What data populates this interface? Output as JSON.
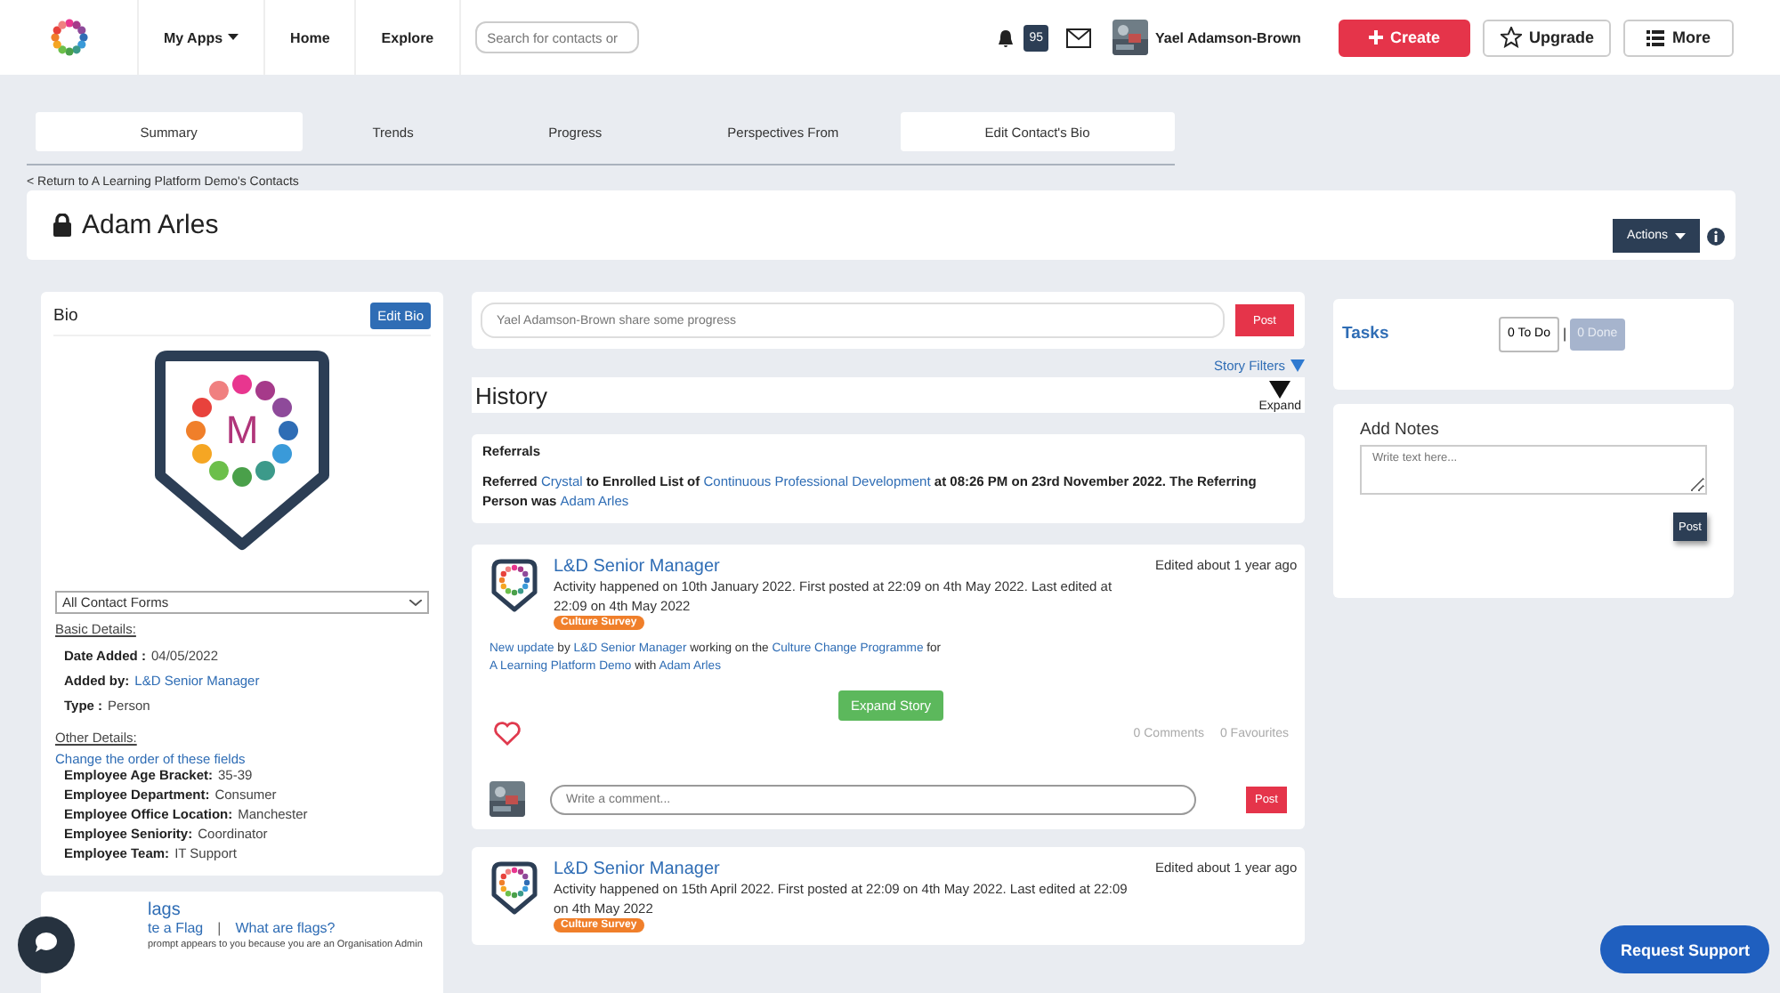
{
  "nav": {
    "menu": [
      {
        "label": "My Apps",
        "dropdown": true
      },
      {
        "label": "Home",
        "dropdown": false
      },
      {
        "label": "Explore",
        "dropdown": false
      }
    ],
    "search": {
      "placeholder": "Search for contacts or"
    },
    "notifications": "95",
    "user": "Yael Adamson-Brown",
    "buttons": [
      {
        "label": "Create",
        "kind": "primary"
      },
      {
        "label": "Upgrade",
        "kind": "star"
      },
      {
        "label": "More",
        "kind": "list"
      }
    ]
  },
  "tabs": [
    {
      "label": "Summary",
      "selected": true,
      "kind": "tab"
    },
    {
      "label": "Trends",
      "selected": false,
      "kind": "tab"
    },
    {
      "label": "Progress",
      "selected": false,
      "kind": "tab"
    },
    {
      "label": "Perspectives From",
      "selected": false,
      "kind": "tab"
    },
    {
      "label": "Edit Contact's Bio",
      "kind": "button"
    }
  ],
  "back_link": "< Return to A Learning Platform Demo's Contacts",
  "contact": {
    "name": "Adam Arles",
    "locked": true,
    "actions": "Actions"
  },
  "bio": {
    "title": "Bio",
    "edit": "Edit Bio",
    "logo_letter": "M",
    "form_select": "All Contact Forms",
    "basic_heading": "Basic Details:",
    "basic": [
      {
        "label": "Date Added :",
        "value": "04/05/2022",
        "kind": "text"
      },
      {
        "label": "Added by:",
        "value": "L&D Senior Manager",
        "kind": "link"
      },
      {
        "label": "Type :",
        "value": "Person",
        "kind": "text"
      }
    ],
    "other_heading": "Other Details:",
    "reorder_link": "Change the order of these fields",
    "other": [
      {
        "label": "Employee Age Bracket:",
        "value": "35-39"
      },
      {
        "label": "Employee Department:",
        "value": "Consumer"
      },
      {
        "label": "Employee Office Location:",
        "value": "Manchester"
      },
      {
        "label": "Employee Seniority:",
        "value": "Coordinator"
      },
      {
        "label": "Employee Team:",
        "value": "IT Support"
      }
    ]
  },
  "flags": {
    "title": "lags",
    "links": [
      "te a Flag",
      "What are flags?"
    ],
    "separator": "|",
    "note": "prompt appears to you because you are an Organisation Admin"
  },
  "composer": {
    "placeholder": "Yael Adamson-Brown share some progress",
    "button": "Post"
  },
  "story_filters": "Story Filters",
  "history": {
    "title": "History",
    "expand": "Expand"
  },
  "referrals": {
    "title": "Referrals",
    "parts": [
      {
        "kind": "text",
        "text": "Referred"
      },
      {
        "kind": "link",
        "text": "Crystal"
      },
      {
        "kind": "text",
        "text": "to Enrolled List of"
      },
      {
        "kind": "link",
        "text": "Continuous Professional Development"
      },
      {
        "kind": "text",
        "text": "at 08:26 PM on 23rd November 2022. The Referring Person was"
      },
      {
        "kind": "link",
        "text": "Adam Arles"
      }
    ]
  },
  "stories": [
    {
      "author": "L&D Senior Manager",
      "activity": "Activity happened on 10th January 2022. First posted at 22:09 on 4th May 2022. Last edited at 22:09 on 4th May 2022",
      "edited": "Edited about 1 year ago",
      "tag": "Culture Survey",
      "update": [
        {
          "kind": "link",
          "text": "New update"
        },
        {
          "kind": "text",
          "text": "by"
        },
        {
          "kind": "link",
          "text": "L&D Senior Manager"
        },
        {
          "kind": "text",
          "text": "working on the"
        },
        {
          "kind": "link",
          "text": "Culture Change Programme"
        },
        {
          "kind": "text",
          "text": "for"
        },
        {
          "kind": "link",
          "text": "A Learning Platform Demo"
        },
        {
          "kind": "text",
          "text": "with"
        },
        {
          "kind": "link",
          "text": "Adam Arles"
        }
      ],
      "expand": "Expand Story",
      "favourited": false,
      "comments": "0 Comments",
      "favourites": "0 Favourites",
      "comment_placeholder": "Write a comment...",
      "post": "Post"
    },
    {
      "author": "L&D Senior Manager",
      "activity": "Activity happened on 15th April 2022. First posted at 22:09 on 4th May 2022. Last edited at 22:09 on 4th May 2022",
      "edited": "Edited about 1 year ago",
      "tag": "Culture Survey"
    }
  ],
  "tasks": {
    "title": "Tasks",
    "todo": "0 To Do",
    "separator": "|",
    "done": "0 Done",
    "done_disabled": true
  },
  "notes": {
    "title": "Add Notes",
    "placeholder": "Write text here...",
    "button": "Post"
  },
  "support": "Request Support"
}
